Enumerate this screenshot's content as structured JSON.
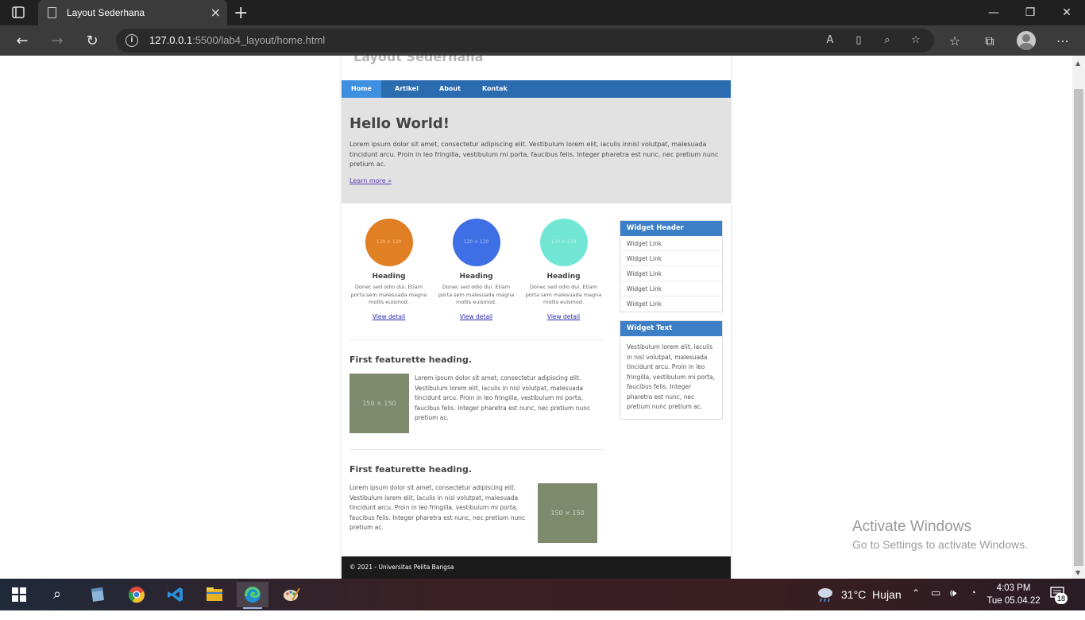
{
  "browser": {
    "tab_title": "Layout Sederhana",
    "url_host": "127.0.0.1",
    "url_rest": ":5500/lab4_layout/home.html",
    "new_tab": "+",
    "minimize": "—",
    "restore": "❐",
    "close": "✕"
  },
  "page": {
    "site_title": "Layout Sederhana",
    "menu": [
      "Home",
      "Artikel",
      "About",
      "Kontak"
    ],
    "hero": {
      "heading": "Hello World!",
      "text": "Lorem ipsum dolor sit amet, consectetur adipiscing elit. Vestibulum lorem elit, iaculis innisl volutpat, malesuada tincidunt arcu. Proin in leo fringilla, vestibulum mi porta, faucibus felis. Integer pharetra est nunc, nec pretium nunc pretium ac.",
      "link": "Learn more »"
    },
    "features": [
      {
        "placeholder": "120 × 120",
        "color": "#e07f24",
        "heading": "Heading",
        "text": "Donec sed odio dui. Etiam porta sem malesuada magna mollis euismod.",
        "link": "View detail"
      },
      {
        "placeholder": "120 × 120",
        "color": "#3f6fe4",
        "heading": "Heading",
        "text": "Donec sed odio dui. Etiam porta sem malesuada magna mollis euismod.",
        "link": "View detail"
      },
      {
        "placeholder": "120 × 120",
        "color": "#72e6d5",
        "heading": "Heading",
        "text": "Donec sed odio dui. Etiam porta sem malesuada magna mollis euismod.",
        "link": "View detail"
      }
    ],
    "featurettes": [
      {
        "heading": "First featurette heading.",
        "placeholder": "150 × 150",
        "text": "Lorem ipsum dolor sit amet, consectetur adipiscing elit. Vestibulum lorem elit, iaculis in nisl volutpat, malesuada tincidunt arcu. Proin in leo fringilla, vestibulum mi porta, faucibus felis. Integer pharetra est nunc, nec pretium nunc pretium ac."
      },
      {
        "heading": "First featurette heading.",
        "placeholder": "150 × 150",
        "text": "Lorem ipsum dolor sit amet, consectetur adipiscing elit. Vestibulum lorem elit, iaculis in nisl volutpat, malesuada tincidunt arcu. Proin in leo fringilla, vestibulum mi porta, faucibus felis. Integer pharetra est nunc, nec pretium nunc pretium ac."
      }
    ],
    "widget_links": {
      "header": "Widget Header",
      "links": [
        "Widget Link",
        "Widget Link",
        "Widget Link",
        "Widget Link",
        "Widget Link"
      ]
    },
    "widget_text": {
      "header": "Widget Text",
      "text": "Vestibulum lorem elit, iaculis in nisl volutpat, malesuada tincidunt arcu. Proin in leo fringilla, vestibulum mi porta, faucibus felis. Integer pharetra est nunc, nec pretium nunc pretium ac."
    },
    "footer": "© 2021 - Universitas Pelita Bangsa"
  },
  "watermark": {
    "line1": "Activate Windows",
    "line2": "Go to Settings to activate Windows."
  },
  "taskbar": {
    "weather": "31°C  Hujan",
    "time": "4:03 PM",
    "date": "Tue 05.04.22",
    "notifications": "18"
  }
}
